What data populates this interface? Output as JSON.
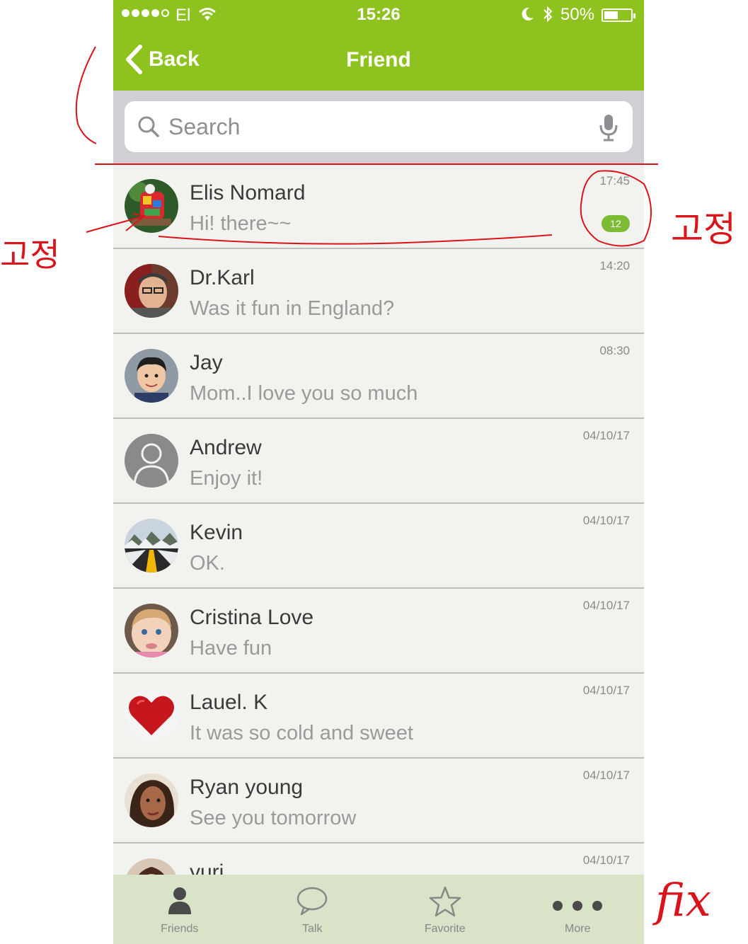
{
  "status_bar": {
    "carrier": "El",
    "time": "15:26",
    "battery": "50%"
  },
  "nav": {
    "back_label": "Back",
    "title": "Friend"
  },
  "search": {
    "placeholder": "Search"
  },
  "conversations": [
    {
      "name": "Elis Nomard",
      "message": "Hi! there~~",
      "time": "17:45",
      "unread": "12",
      "avatar": "toy-robot"
    },
    {
      "name": "Dr.Karl",
      "message": "Was it fun in England?",
      "time": "14:20",
      "avatar": "man-glasses"
    },
    {
      "name": "Jay",
      "message": "Mom..I love you so much",
      "time": "08:30",
      "avatar": "boy"
    },
    {
      "name": "Andrew",
      "message": "Enjoy it!",
      "time": "04/10/17",
      "avatar": "default-person"
    },
    {
      "name": "Kevin",
      "message": "OK.",
      "time": "04/10/17",
      "avatar": "snowy-road"
    },
    {
      "name": "Cristina Love",
      "message": "Have fun",
      "time": "04/10/17",
      "avatar": "baby"
    },
    {
      "name": "Lauel. K",
      "message": "It was so cold and sweet",
      "time": "04/10/17",
      "avatar": "red-heart"
    },
    {
      "name": "Ryan young",
      "message": "See you tomorrow",
      "time": "04/10/17",
      "avatar": "woman"
    },
    {
      "name": "yuri",
      "message": "",
      "time": "04/10/17",
      "avatar": "woman-2"
    }
  ],
  "tabs": [
    {
      "label": "Friends",
      "icon": "person-icon"
    },
    {
      "label": "Talk",
      "icon": "speech-bubble-icon"
    },
    {
      "label": "Favorite",
      "icon": "star-icon"
    },
    {
      "label": "More",
      "icon": "more-dots-icon"
    }
  ],
  "annotations": {
    "fixed_korean": "고정",
    "fix": "fix",
    "color": "#d9141a"
  },
  "colors": {
    "nav_green": "#8dc21f",
    "badge_green": "#7dbb35",
    "tabbar_bg": "#d9e3c8"
  }
}
